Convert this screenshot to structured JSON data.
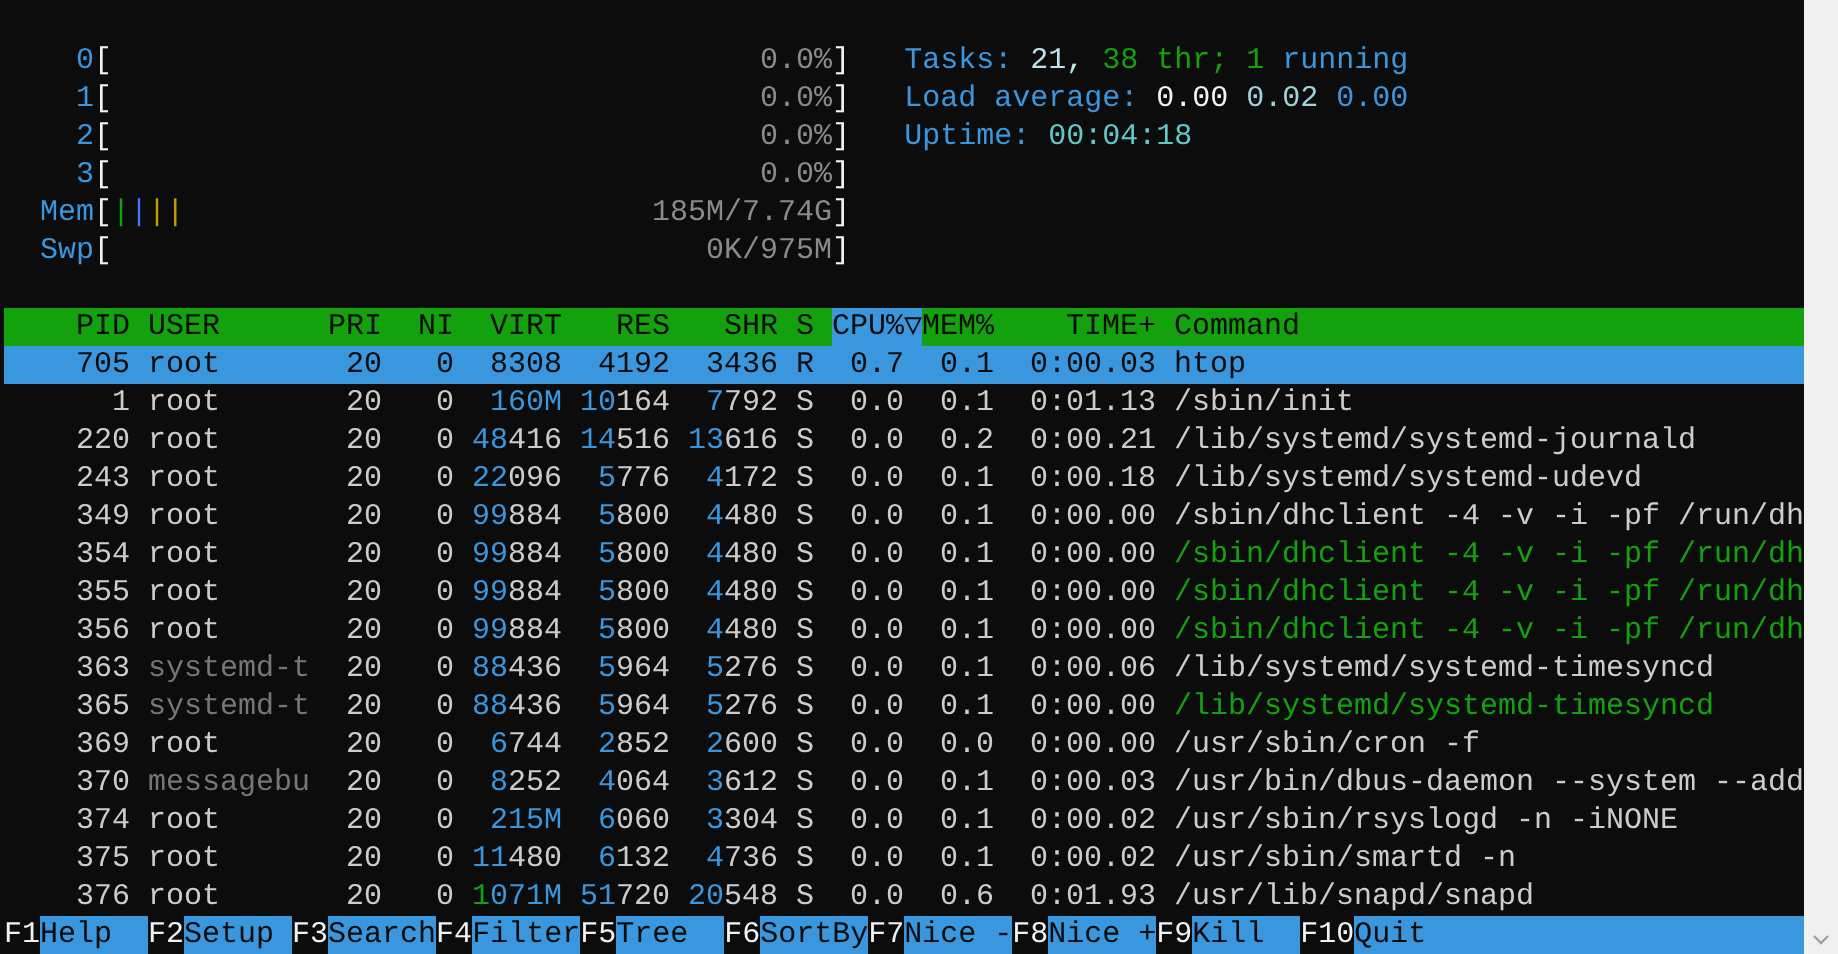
{
  "meters": [
    {
      "label": "0",
      "open": "[",
      "value": "0.0%",
      "close": "]"
    },
    {
      "label": "1",
      "open": "[",
      "value": "0.0%",
      "close": "]"
    },
    {
      "label": "2",
      "open": "[",
      "value": "0.0%",
      "close": "]"
    },
    {
      "label": "3",
      "open": "[",
      "value": "0.0%",
      "close": "]"
    },
    {
      "label": "Mem",
      "open": "[",
      "value": "185M/7.74G",
      "close": "]",
      "bars": [
        {
          "text": "|",
          "color": "#13a10e"
        },
        {
          "text": "|",
          "color": "#3b78ff"
        },
        {
          "text": "|",
          "color": "#c19c00"
        },
        {
          "text": "|",
          "color": "#c19c00"
        }
      ]
    },
    {
      "label": "Swp",
      "open": "[",
      "value": "0K/975M",
      "close": "]"
    }
  ],
  "summary": [
    {
      "parts": [
        {
          "text": "Tasks:",
          "color": "#3a96dd"
        },
        {
          "text": "21,",
          "color": "#bfe3ea"
        },
        {
          "text": "38 thr;",
          "color": "#13a10e"
        },
        {
          "text": "1",
          "color": "#13a10e"
        },
        {
          "text": "running",
          "color": "#3a96dd"
        }
      ]
    },
    {
      "parts": [
        {
          "text": "Load average:",
          "color": "#3a96dd"
        },
        {
          "text": "0.00",
          "color": "#f2f2f2"
        },
        {
          "text": "0.02",
          "color": "#9fd3dc"
        },
        {
          "text": "0.00",
          "color": "#3a96dd"
        }
      ]
    },
    {
      "parts": [
        {
          "text": "Uptime:",
          "color": "#3a96dd"
        },
        {
          "text": "00:04:18",
          "color": "#61c8c8"
        }
      ]
    }
  ],
  "columns": [
    {
      "label": "PID",
      "selected": false
    },
    {
      "label": "USER",
      "selected": false
    },
    {
      "label": "PRI",
      "selected": false
    },
    {
      "label": "NI",
      "selected": false
    },
    {
      "label": "VIRT",
      "selected": false
    },
    {
      "label": "RES",
      "selected": false
    },
    {
      "label": "SHR",
      "selected": false
    },
    {
      "label": "S",
      "selected": false
    },
    {
      "label": "CPU%",
      "sort_mark": "▽",
      "selected": true
    },
    {
      "label": "MEM%",
      "selected": false
    },
    {
      "label": "TIME+",
      "selected": false
    },
    {
      "label": "Command",
      "selected": false
    }
  ],
  "rows": [
    {
      "pid": "705",
      "user": "root",
      "pri": "20",
      "ni": "0",
      "virt": "8308",
      "res": "4192",
      "shr": "3436",
      "state": "R",
      "cpu": "0.7",
      "mem": "0.1",
      "time": "0:00.03",
      "command": "htop",
      "selected": true
    },
    {
      "pid": "1",
      "user": "root",
      "pri": "20",
      "ni": "0",
      "virt": "160M",
      "res": "10164",
      "shr": "7792",
      "state": "S",
      "cpu": "0.0",
      "mem": "0.1",
      "time": "0:01.13",
      "command": "/sbin/init",
      "selected": false,
      "thread": false,
      "dimmed_user": false
    },
    {
      "pid": "220",
      "user": "root",
      "pri": "20",
      "ni": "0",
      "virt": "48416",
      "res": "14516",
      "shr": "13616",
      "state": "S",
      "cpu": "0.0",
      "mem": "0.2",
      "time": "0:00.21",
      "command": "/lib/systemd/systemd-journald",
      "selected": false,
      "thread": false,
      "dimmed_user": false
    },
    {
      "pid": "243",
      "user": "root",
      "pri": "20",
      "ni": "0",
      "virt": "22096",
      "res": "5776",
      "shr": "4172",
      "state": "S",
      "cpu": "0.0",
      "mem": "0.1",
      "time": "0:00.18",
      "command": "/lib/systemd/systemd-udevd",
      "selected": false,
      "thread": false,
      "dimmed_user": false
    },
    {
      "pid": "349",
      "user": "root",
      "pri": "20",
      "ni": "0",
      "virt": "99884",
      "res": "5800",
      "shr": "4480",
      "state": "S",
      "cpu": "0.0",
      "mem": "0.1",
      "time": "0:00.00",
      "command": "/sbin/dhclient -4 -v -i -pf /run/dh",
      "selected": false,
      "thread": false,
      "dimmed_user": false
    },
    {
      "pid": "354",
      "user": "root",
      "pri": "20",
      "ni": "0",
      "virt": "99884",
      "res": "5800",
      "shr": "4480",
      "state": "S",
      "cpu": "0.0",
      "mem": "0.1",
      "time": "0:00.00",
      "command": "/sbin/dhclient -4 -v -i -pf /run/dh",
      "selected": false,
      "thread": true,
      "dimmed_user": false
    },
    {
      "pid": "355",
      "user": "root",
      "pri": "20",
      "ni": "0",
      "virt": "99884",
      "res": "5800",
      "shr": "4480",
      "state": "S",
      "cpu": "0.0",
      "mem": "0.1",
      "time": "0:00.00",
      "command": "/sbin/dhclient -4 -v -i -pf /run/dh",
      "selected": false,
      "thread": true,
      "dimmed_user": false
    },
    {
      "pid": "356",
      "user": "root",
      "pri": "20",
      "ni": "0",
      "virt": "99884",
      "res": "5800",
      "shr": "4480",
      "state": "S",
      "cpu": "0.0",
      "mem": "0.1",
      "time": "0:00.00",
      "command": "/sbin/dhclient -4 -v -i -pf /run/dh",
      "selected": false,
      "thread": true,
      "dimmed_user": false
    },
    {
      "pid": "363",
      "user": "systemd-t",
      "pri": "20",
      "ni": "0",
      "virt": "88436",
      "res": "5964",
      "shr": "5276",
      "state": "S",
      "cpu": "0.0",
      "mem": "0.1",
      "time": "0:00.06",
      "command": "/lib/systemd/systemd-timesyncd",
      "selected": false,
      "thread": false,
      "dimmed_user": true
    },
    {
      "pid": "365",
      "user": "systemd-t",
      "pri": "20",
      "ni": "0",
      "virt": "88436",
      "res": "5964",
      "shr": "5276",
      "state": "S",
      "cpu": "0.0",
      "mem": "0.1",
      "time": "0:00.00",
      "command": "/lib/systemd/systemd-timesyncd",
      "selected": false,
      "thread": true,
      "dimmed_user": true
    },
    {
      "pid": "369",
      "user": "root",
      "pri": "20",
      "ni": "0",
      "virt": "6744",
      "res": "2852",
      "shr": "2600",
      "state": "S",
      "cpu": "0.0",
      "mem": "0.0",
      "time": "0:00.00",
      "command": "/usr/sbin/cron -f",
      "selected": false,
      "thread": false,
      "dimmed_user": false
    },
    {
      "pid": "370",
      "user": "messagebu",
      "pri": "20",
      "ni": "0",
      "virt": "8252",
      "res": "4064",
      "shr": "3612",
      "state": "S",
      "cpu": "0.0",
      "mem": "0.1",
      "time": "0:00.03",
      "command": "/usr/bin/dbus-daemon --system --add",
      "selected": false,
      "thread": false,
      "dimmed_user": true
    },
    {
      "pid": "374",
      "user": "root",
      "pri": "20",
      "ni": "0",
      "virt": "215M",
      "res": "6060",
      "shr": "3304",
      "state": "S",
      "cpu": "0.0",
      "mem": "0.1",
      "time": "0:00.02",
      "command": "/usr/sbin/rsyslogd -n -iNONE",
      "selected": false,
      "thread": false,
      "dimmed_user": false
    },
    {
      "pid": "375",
      "user": "root",
      "pri": "20",
      "ni": "0",
      "virt": "11480",
      "res": "6132",
      "shr": "4736",
      "state": "S",
      "cpu": "0.0",
      "mem": "0.1",
      "time": "0:00.02",
      "command": "/usr/sbin/smartd -n",
      "selected": false,
      "thread": false,
      "dimmed_user": false
    },
    {
      "pid": "376",
      "user": "root",
      "pri": "20",
      "ni": "0",
      "virt": "1071M",
      "res": "51720",
      "shr": "20548",
      "state": "S",
      "cpu": "0.0",
      "mem": "0.6",
      "time": "0:01.93",
      "command": "/usr/lib/snapd/snapd",
      "selected": false,
      "thread": false,
      "dimmed_user": false
    }
  ],
  "footer": [
    {
      "key": "F1",
      "label": "Help"
    },
    {
      "key": "F2",
      "label": "Setup"
    },
    {
      "key": "F3",
      "label": "Search"
    },
    {
      "key": "F4",
      "label": "Filter"
    },
    {
      "key": "F5",
      "label": "Tree"
    },
    {
      "key": "F6",
      "label": "SortBy"
    },
    {
      "key": "F7",
      "label": "Nice -"
    },
    {
      "key": "F8",
      "label": "Nice +"
    },
    {
      "key": "F9",
      "label": "Kill"
    },
    {
      "key": "F10",
      "label": "Quit"
    }
  ]
}
